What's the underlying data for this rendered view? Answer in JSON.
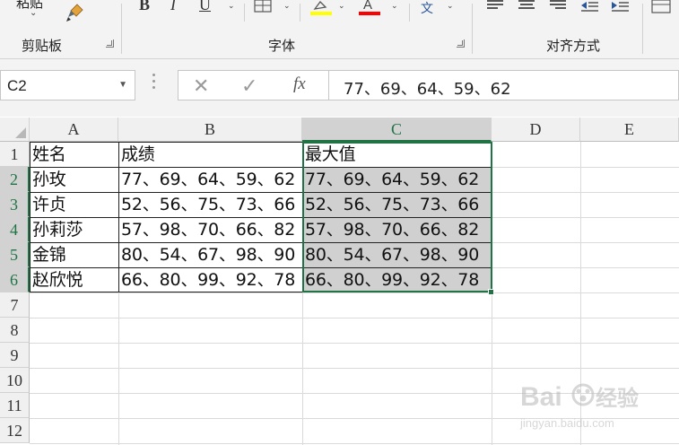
{
  "ribbon": {
    "paste_label": "粘贴",
    "groups": {
      "clipboard": "剪贴板",
      "font": "字体",
      "alignment": "对齐方式"
    },
    "font_buttons": {
      "bold": "B",
      "italic": "I",
      "underline": "U"
    },
    "phonetic_label": "文",
    "colors": {
      "highlight": "#ffff00",
      "font_color": "#ff0000"
    }
  },
  "formula_bar": {
    "name_box": "C2",
    "fx_label": "fx",
    "cancel_icon": "✕",
    "enter_icon": "✓",
    "formula": "77、69、64、59、62"
  },
  "columns": [
    "A",
    "B",
    "C",
    "D",
    "E"
  ],
  "rows": [
    "1",
    "2",
    "3",
    "4",
    "5",
    "6",
    "7",
    "8",
    "9",
    "10",
    "11",
    "12"
  ],
  "table": {
    "headers": [
      "姓名",
      "成绩",
      "最大值"
    ],
    "data": [
      [
        "孙玫",
        "77、69、64、59、62",
        "77、69、64、59、62"
      ],
      [
        "许贞",
        "52、56、75、73、66",
        "52、56、75、73、66"
      ],
      [
        "孙莉莎",
        "57、98、70、66、82",
        "57、98、70、66、82"
      ],
      [
        "金锦",
        "80、54、67、98、90",
        "80、54、67、98、90"
      ],
      [
        "赵欣悦",
        "66、80、99、92、78",
        "66、80、99、92、78"
      ]
    ]
  },
  "watermark": {
    "brand": "Bai",
    "brand2": "经验",
    "url": "jingyan.baidu.com"
  },
  "accent_color": "#217346"
}
